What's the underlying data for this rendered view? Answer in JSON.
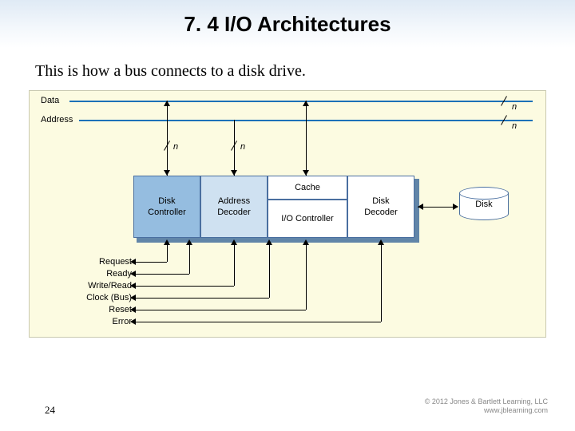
{
  "header": {
    "title": "7. 4 I/O Architectures"
  },
  "subtitle": "This is how a bus connects to a disk drive.",
  "buses": {
    "data": {
      "label": "Data",
      "width_symbol": "n"
    },
    "address": {
      "label": "Address",
      "width_symbol": "n"
    }
  },
  "taps": {
    "disk_controller": "n",
    "address_decoder": "n"
  },
  "blocks": {
    "disk_controller": "Disk\nController",
    "address_decoder": "Address\nDecoder",
    "cache": "Cache",
    "io_controller": "I/O Controller",
    "disk_decoder": "Disk\nDecoder",
    "disk": "Disk"
  },
  "signals": [
    "Request",
    "Ready",
    "Write/Read",
    "Clock (Bus)",
    "Reset",
    "Error"
  ],
  "page_number": "24",
  "copyright": {
    "line1": "© 2012 Jones & Bartlett Learning, LLC",
    "line2": "www.jblearning.com"
  }
}
